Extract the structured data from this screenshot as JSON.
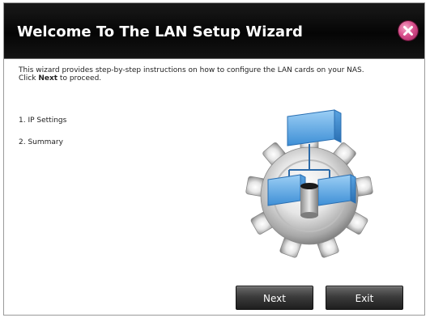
{
  "dialog": {
    "title": "Welcome To The LAN Setup Wizard",
    "close_icon": "close-icon"
  },
  "intro": {
    "line1": "This wizard provides step-by-step instructions on how to configure the LAN cards on your NAS.",
    "line2_prefix": "Click ",
    "line2_bold": "Next",
    "line2_suffix": " to proceed."
  },
  "steps": [
    "1. IP Settings",
    "2. Summary"
  ],
  "illustration": {
    "icon": "network-gear-icon"
  },
  "buttons": {
    "next_label": "Next",
    "exit_label": "Exit"
  }
}
